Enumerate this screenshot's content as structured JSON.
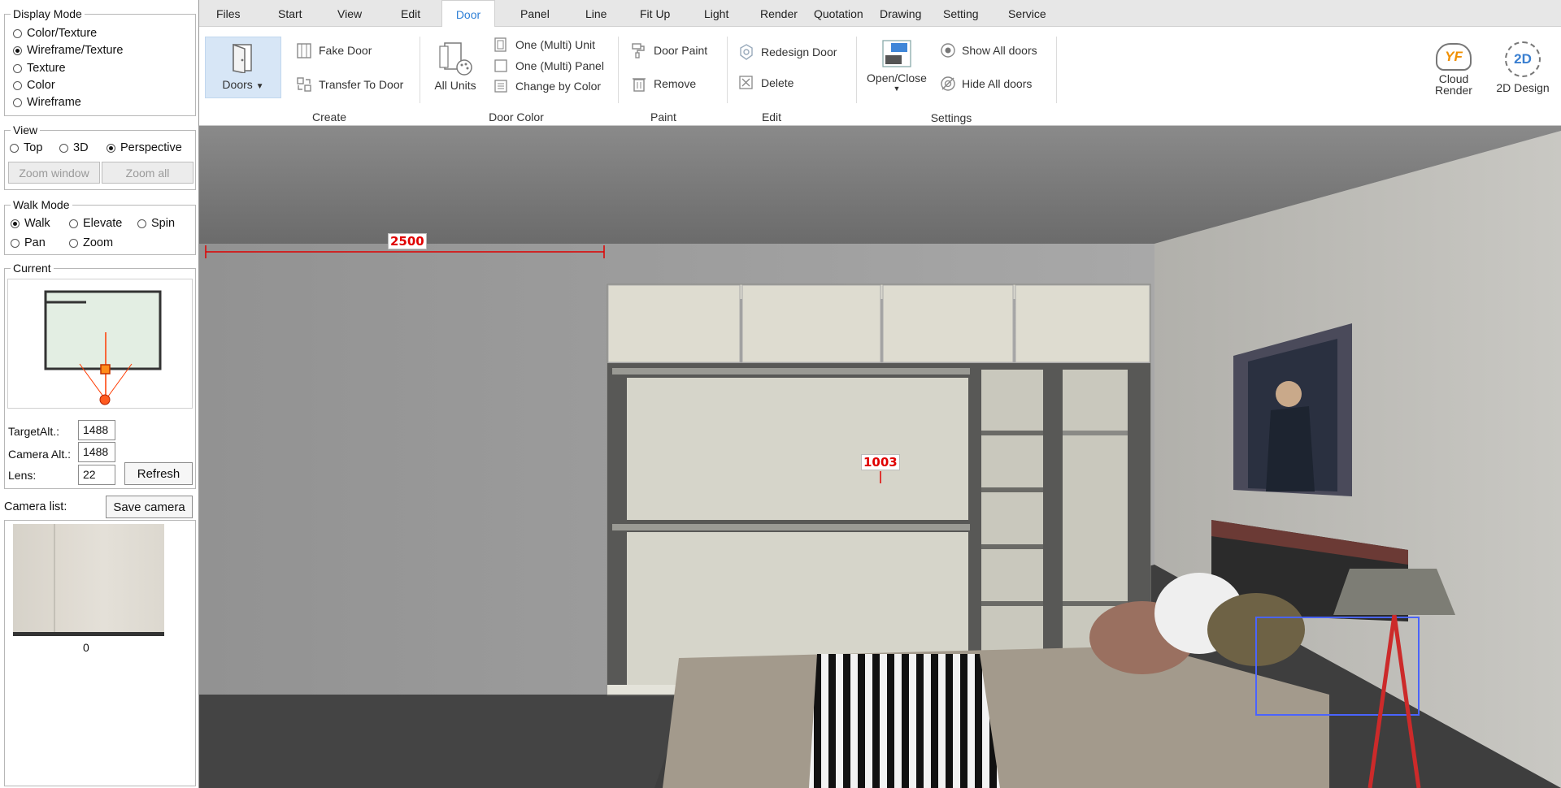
{
  "display_mode": {
    "title": "Display Mode",
    "options": [
      "Color/Texture",
      "Wireframe/Texture",
      "Texture",
      "Color",
      "Wireframe"
    ],
    "selected": "Wireframe/Texture"
  },
  "view": {
    "title": "View",
    "options": [
      "Top",
      "3D",
      "Perspective"
    ],
    "selected": "Perspective",
    "zoom_window": "Zoom window",
    "zoom_all": "Zoom all"
  },
  "walk_mode": {
    "title": "Walk Mode",
    "options": [
      "Walk",
      "Elevate",
      "Spin",
      "Pan",
      "Zoom"
    ],
    "selected": "Walk"
  },
  "current": {
    "title": "Current",
    "target_alt_label": "TargetAlt.:",
    "target_alt": "1488",
    "camera_alt_label": "Camera Alt.:",
    "camera_alt": "1488",
    "lens_label": "Lens:",
    "lens": "22",
    "refresh": "Refresh"
  },
  "camera_list": {
    "label": "Camera list:",
    "save": "Save camera",
    "items": [
      {
        "caption": "0"
      }
    ]
  },
  "tabs": [
    "Files",
    "Start",
    "View",
    "Edit",
    "Door",
    "Panel",
    "Line",
    "Fit Up",
    "Light",
    "Render",
    "Quotation",
    "Drawing",
    "Setting",
    "Service"
  ],
  "active_tab": "Door",
  "ribbon": {
    "doors": "Doors",
    "fake_door": "Fake Door",
    "transfer_to_door": "Transfer To Door",
    "create": "Create",
    "all_units": "All Units",
    "one_multi_unit": "One (Multi) Unit",
    "one_multi_panel": "One (Multi) Panel",
    "change_by_color": "Change by Color",
    "door_color": "Door Color",
    "door_paint": "Door Paint",
    "remove": "Remove",
    "paint": "Paint",
    "redesign_door": "Redesign Door",
    "delete": "Delete",
    "edit": "Edit",
    "open_close": "Open/Close",
    "show_all_doors": "Show All doors",
    "hide_all_doors": "Hide All doors",
    "settings": "Settings",
    "cloud_render": "Cloud Render",
    "design_2d": "2D Design",
    "logo_text": "YF",
    "badge_2d": "2D"
  },
  "viewport": {
    "dim_width": "2500",
    "dim_height": "1003"
  }
}
